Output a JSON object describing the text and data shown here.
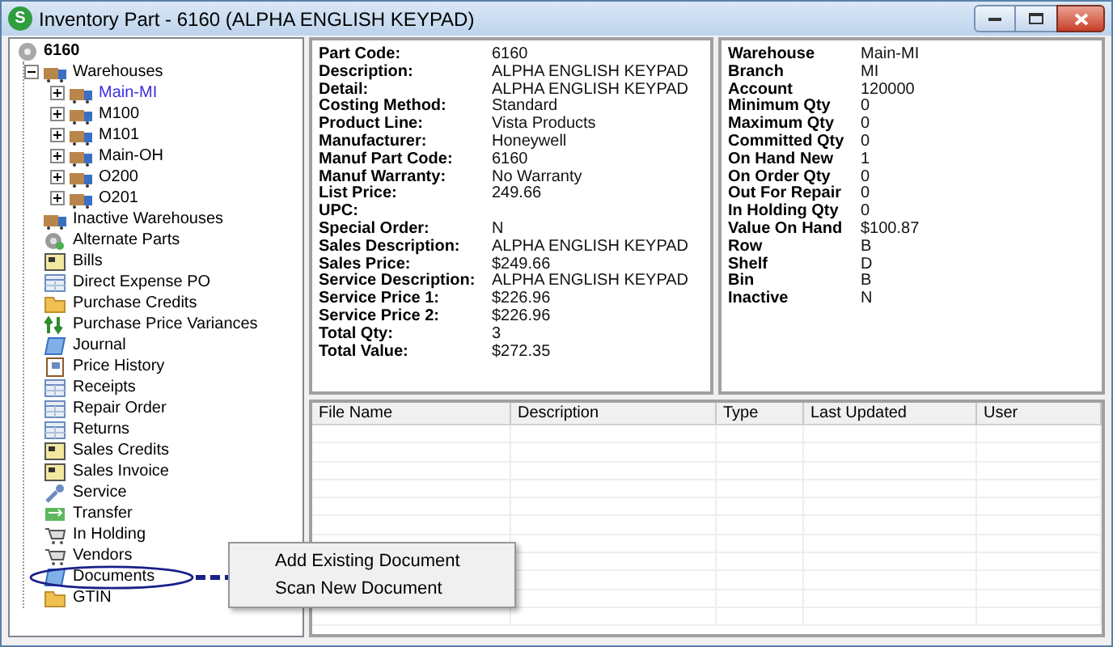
{
  "window": {
    "title": "Inventory Part - 6160 (ALPHA ENGLISH KEYPAD)",
    "app_icon": "S"
  },
  "tree": {
    "root": "6160",
    "items": [
      {
        "label": "Warehouses",
        "kind": "warehouse",
        "expanded": true,
        "selected": false,
        "children": [
          {
            "label": "Main-MI",
            "kind": "warehouse",
            "expanded": false,
            "selected": true
          },
          {
            "label": "M100",
            "kind": "warehouse",
            "expanded": false,
            "selected": false
          },
          {
            "label": "M101",
            "kind": "warehouse",
            "expanded": false,
            "selected": false
          },
          {
            "label": "Main-OH",
            "kind": "warehouse",
            "expanded": false,
            "selected": false
          },
          {
            "label": "O200",
            "kind": "warehouse",
            "expanded": false,
            "selected": false
          },
          {
            "label": "O201",
            "kind": "warehouse",
            "expanded": false,
            "selected": false
          }
        ]
      },
      {
        "label": "Inactive Warehouses",
        "kind": "warehouse",
        "selected": false
      },
      {
        "label": "Alternate Parts",
        "kind": "gear",
        "selected": false
      },
      {
        "label": "Bills",
        "kind": "bill",
        "selected": false
      },
      {
        "label": "Direct Expense PO",
        "kind": "grid",
        "selected": false
      },
      {
        "label": "Purchase Credits",
        "kind": "folder",
        "selected": false
      },
      {
        "label": "Purchase Price Variances",
        "kind": "arrows",
        "selected": false
      },
      {
        "label": "Journal",
        "kind": "journal",
        "selected": false
      },
      {
        "label": "Price History",
        "kind": "book",
        "selected": false
      },
      {
        "label": "Receipts",
        "kind": "grid",
        "selected": false
      },
      {
        "label": "Repair Order",
        "kind": "grid",
        "selected": false
      },
      {
        "label": "Returns",
        "kind": "grid",
        "selected": false
      },
      {
        "label": "Sales Credits",
        "kind": "bill",
        "selected": false
      },
      {
        "label": "Sales Invoice",
        "kind": "bill",
        "selected": false
      },
      {
        "label": "Service",
        "kind": "wrench",
        "selected": false
      },
      {
        "label": "Transfer",
        "kind": "transfer",
        "selected": false
      },
      {
        "label": "In Holding",
        "kind": "cart",
        "selected": false
      },
      {
        "label": "Vendors",
        "kind": "cart",
        "selected": false
      },
      {
        "label": "Documents",
        "kind": "journal",
        "selected": false,
        "circled": true
      },
      {
        "label": "GTIN",
        "kind": "folder",
        "selected": false
      }
    ]
  },
  "part_details": [
    {
      "label": "Part Code:",
      "value": "6160"
    },
    {
      "label": "Description:",
      "value": "ALPHA ENGLISH KEYPAD"
    },
    {
      "label": "Detail:",
      "value": "ALPHA ENGLISH KEYPAD"
    },
    {
      "label": "Costing Method:",
      "value": "Standard"
    },
    {
      "label": "Product Line:",
      "value": "Vista Products"
    },
    {
      "label": "Manufacturer:",
      "value": "Honeywell"
    },
    {
      "label": "Manuf Part Code:",
      "value": "6160"
    },
    {
      "label": "Manuf Warranty:",
      "value": "No Warranty"
    },
    {
      "label": "List Price:",
      "value": "249.66"
    },
    {
      "label": "UPC:"
    },
    {
      "label": "Special Order:",
      "value": "N"
    },
    {
      "label": "Sales Description:",
      "value": "ALPHA ENGLISH KEYPAD"
    },
    {
      "label": "Sales Price:",
      "value": "$249.66"
    },
    {
      "label": "Service Description:",
      "value": "ALPHA ENGLISH KEYPAD"
    },
    {
      "label": "Service Price 1:",
      "value": "$226.96"
    },
    {
      "label": "Service Price 2:",
      "value": "$226.96"
    },
    {
      "label": "Total Qty:",
      "value": "3"
    },
    {
      "label": "Total Value:",
      "value": "$272.35"
    }
  ],
  "warehouse_details": [
    {
      "label": "Warehouse",
      "value": "Main-MI"
    },
    {
      "label": "Branch",
      "value": "MI"
    },
    {
      "label": "Account",
      "value": "120000"
    },
    {
      "label": "Minimum Qty",
      "value": "0"
    },
    {
      "label": "Maximum Qty",
      "value": "0"
    },
    {
      "label": "Committed Qty",
      "value": "0"
    },
    {
      "label": "On Hand New",
      "value": "1"
    },
    {
      "label": "On Order Qty",
      "value": "0"
    },
    {
      "label": "Out For Repair",
      "value": "0"
    },
    {
      "label": "In Holding Qty",
      "value": "0"
    },
    {
      "label": "Value On Hand",
      "value": "$100.87"
    },
    {
      "label": "Row",
      "value": "B"
    },
    {
      "label": "Shelf",
      "value": "D"
    },
    {
      "label": "Bin",
      "value": "B"
    },
    {
      "label": "Inactive",
      "value": "N"
    }
  ],
  "documents_table": {
    "columns": [
      "File Name",
      "Description",
      "Type",
      "Last Updated",
      "User"
    ]
  },
  "context_menu": {
    "items": [
      "Add Existing Document",
      "Scan New Document"
    ]
  }
}
